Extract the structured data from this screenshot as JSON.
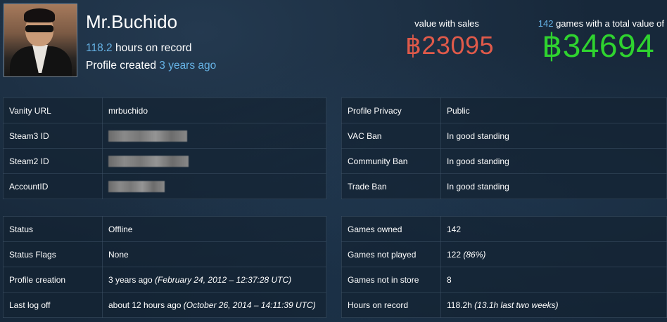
{
  "profile": {
    "name": "Mr.Buchido",
    "hours_value": "118.2",
    "hours_suffix": "hours on record",
    "created_prefix": "Profile created",
    "created_value": "3 years ago"
  },
  "value": {
    "sales_label": "value with sales",
    "sales_amount": "฿23095",
    "games_count": "142",
    "total_label": "games with a total value of",
    "total_amount": "฿34694"
  },
  "colors": {
    "accent_blue": "#66b3e6",
    "sales_red": "#e05a4a",
    "total_green": "#2fd32f"
  },
  "ids_table": {
    "rows": [
      {
        "label": "Vanity URL",
        "value": "mrbuchido"
      },
      {
        "label": "Steam3 ID",
        "value": ""
      },
      {
        "label": "Steam2 ID",
        "value": ""
      },
      {
        "label": "AccountID",
        "value": ""
      }
    ]
  },
  "privacy_table": {
    "rows": [
      {
        "label": "Profile Privacy",
        "value": "Public"
      },
      {
        "label": "VAC Ban",
        "value": "In good standing"
      },
      {
        "label": "Community Ban",
        "value": "In good standing"
      },
      {
        "label": "Trade Ban",
        "value": "In good standing"
      }
    ]
  },
  "status_table": {
    "rows": [
      {
        "label": "Status",
        "value": "Offline",
        "extra": ""
      },
      {
        "label": "Status Flags",
        "value": "None",
        "extra": ""
      },
      {
        "label": "Profile creation",
        "value": "3 years ago",
        "extra": "(February 24, 2012 – 12:37:28 UTC)"
      },
      {
        "label": "Last log off",
        "value": "about 12 hours ago",
        "extra": "(October 26, 2014 – 14:11:39 UTC)"
      }
    ]
  },
  "games_table": {
    "rows": [
      {
        "label": "Games owned",
        "value": "142",
        "extra": ""
      },
      {
        "label": "Games not played",
        "value": "122",
        "extra": "(86%)"
      },
      {
        "label": "Games not in store",
        "value": "8",
        "extra": ""
      },
      {
        "label": "Hours on record",
        "value": "118.2h",
        "extra": "(13.1h last two weeks)"
      }
    ]
  }
}
